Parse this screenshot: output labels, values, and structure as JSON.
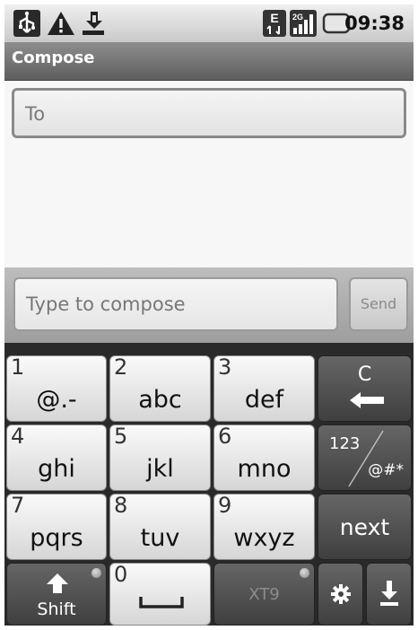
{
  "status_bar": {
    "time": "09:38",
    "left_icons": [
      "usb-icon",
      "warning-icon",
      "download-notification-icon"
    ],
    "right_icons": [
      "edge-data-icon",
      "signal-2g-icon",
      "battery-icon"
    ],
    "network_letter": "E",
    "network_type": "2G"
  },
  "title_bar": {
    "title": "Compose"
  },
  "recipient": {
    "placeholder": "To"
  },
  "composer": {
    "placeholder": "Type to compose",
    "send_label": "Send"
  },
  "keyboard": {
    "keys": [
      {
        "num": "1",
        "label": "@.-"
      },
      {
        "num": "2",
        "label": "abc"
      },
      {
        "num": "3",
        "label": "def"
      },
      {
        "num": "4",
        "label": "ghi"
      },
      {
        "num": "5",
        "label": "jkl"
      },
      {
        "num": "6",
        "label": "mno"
      },
      {
        "num": "7",
        "label": "pqrs"
      },
      {
        "num": "8",
        "label": "tuv"
      },
      {
        "num": "9",
        "label": "wxyz"
      },
      {
        "num": "0",
        "label": ""
      }
    ],
    "clear_label": "C",
    "mode_top": "123",
    "mode_bottom": "@#*",
    "next_label": "next",
    "shift_label": "Shift",
    "xt9_label": "XT9",
    "icons": {
      "clear": "backspace-icon",
      "shift": "shift-arrow-icon",
      "space": "space-bar-icon",
      "settings": "gear-icon",
      "hide": "hide-keyboard-icon"
    }
  }
}
